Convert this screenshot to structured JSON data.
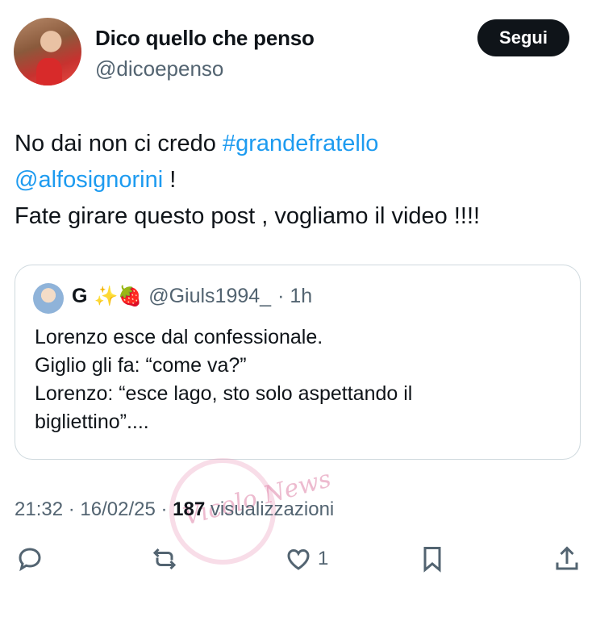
{
  "author": {
    "name": "Dico quello che penso",
    "handle": "@dicoepenso",
    "follow_label": "Segui"
  },
  "tweet": {
    "text_part1": "No dai non ci credo ",
    "hashtag": "#grandefratello",
    "mention": "@alfosignorini",
    "text_part2": " !",
    "line3": "Fate girare questo post , vogliamo il video !!!!"
  },
  "quote": {
    "name": "G",
    "emojis": "✨🍓",
    "handle": "@Giuls1994_",
    "time": "· 1h",
    "lines": [
      "Lorenzo esce dal confessionale.",
      "Giglio gli fa: “come va?”",
      "Lorenzo: “esce lago, sto solo aspettando il",
      "bigliettino”...."
    ]
  },
  "meta": {
    "time": "21:32 · 16/02/25 · ",
    "views": "187",
    "views_label": " visualizzazioni"
  },
  "actions": {
    "reply_icon": "reply-icon",
    "retweet_icon": "retweet-icon",
    "like_icon": "heart-icon",
    "like_count": "1",
    "bookmark_icon": "bookmark-icon",
    "share_icon": "share-icon"
  },
  "watermark": "Vicolo News",
  "colors": {
    "link": "#1d9bf0",
    "secondary": "#536471",
    "text": "#0f1419"
  }
}
